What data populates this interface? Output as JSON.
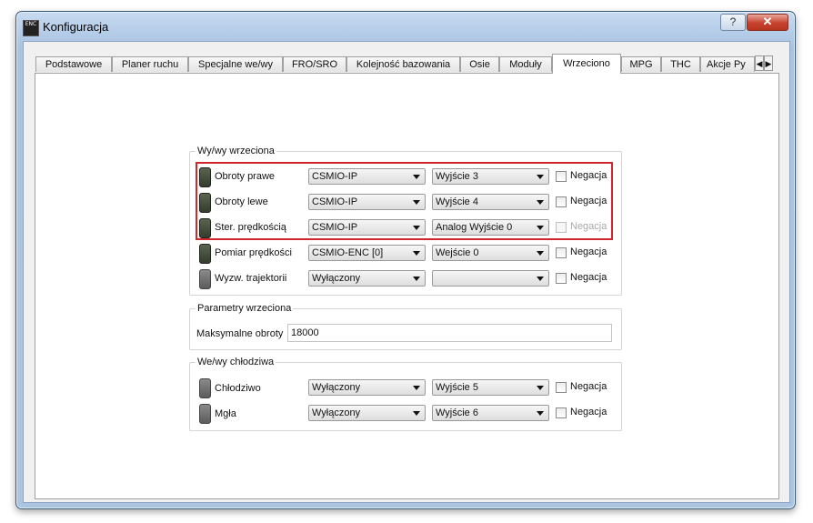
{
  "window": {
    "title": "Konfiguracja",
    "help_label": "?",
    "close_label": "✕",
    "icon_text": "ENC"
  },
  "tabs": [
    "Podstawowe",
    "Planer ruchu",
    "Specjalne we/wy",
    "FRO/SRO",
    "Kolejność bazowania",
    "Osie",
    "Moduły",
    "Wrzeciono",
    "MPG",
    "THC",
    "Akcje Py"
  ],
  "active_tab": "Wrzeciono",
  "tab_scroll": {
    "left": "◀",
    "right": "▶"
  },
  "spindle_io": {
    "title": "Wy/wy wrzeciona",
    "rows": [
      {
        "label": "Obroty prawe",
        "device": "CSMIO-IP",
        "port": "Wyjście 3",
        "negation": "Negacja",
        "negation_enabled": true
      },
      {
        "label": "Obroty lewe",
        "device": "CSMIO-IP",
        "port": "Wyjście 4",
        "negation": "Negacja",
        "negation_enabled": true
      },
      {
        "label": "Ster. prędkością",
        "device": "CSMIO-IP",
        "port": "Analog Wyjście 0",
        "negation": "Negacja",
        "negation_enabled": false
      },
      {
        "label": "Pomiar prędkości",
        "device": "CSMIO-ENC [0]",
        "port": "Wejście 0",
        "negation": "Negacja",
        "negation_enabled": true
      },
      {
        "label": "Wyzw. trajektorii",
        "device": "Wyłączony",
        "port": "",
        "negation": "Negacja",
        "negation_enabled": true
      }
    ]
  },
  "spindle_params": {
    "title": "Parametry wrzeciona",
    "max_speed_label": "Maksymalne obroty",
    "max_speed_value": "18000"
  },
  "coolant_io": {
    "title": "We/wy chłodziwa",
    "rows": [
      {
        "label": "Chłodziwo",
        "device": "Wyłączony",
        "port": "Wyjście 5",
        "negation": "Negacja",
        "negation_enabled": true
      },
      {
        "label": "Mgła",
        "device": "Wyłączony",
        "port": "Wyjście 6",
        "negation": "Negacja",
        "negation_enabled": true
      }
    ]
  },
  "colors": {
    "highlight": "#d0262c",
    "led_dark": "#3c4434",
    "led_grey": "#6e6e6e"
  }
}
